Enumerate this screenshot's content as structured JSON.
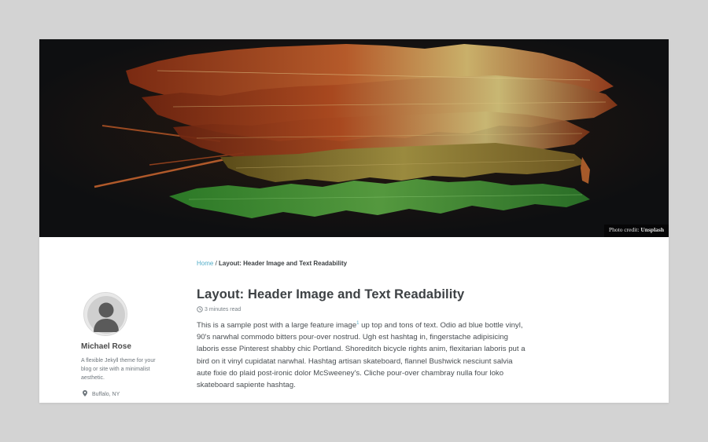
{
  "hero": {
    "photo_credit_prefix": "Photo credit:",
    "photo_credit_source": "Unsplash"
  },
  "breadcrumb": {
    "home": "Home",
    "separator": "/",
    "current": "Layout: Header Image and Text Readability"
  },
  "author": {
    "name": "Michael Rose",
    "bio": "A flexible Jekyll theme for your blog or site with a minimalist aesthetic.",
    "location": "Buffalo, NY",
    "location_icon": "map-marker-icon",
    "avatar_icon": "user-silhouette-icon"
  },
  "post": {
    "title": "Layout: Header Image and Text Readability",
    "read_time": "3 minutes read",
    "read_time_icon": "clock-icon",
    "paragraph_start": "This is a sample post with a large feature image",
    "footnote_ref": "1",
    "paragraph_rest": " up top and tons of text. Odio ad blue bottle vinyl, 90's narwhal commodo bitters pour-over nostrud. Ugh est hashtag in, fingerstache adipisicing laboris esse Pinterest shabby chic Portland. Shoreditch bicycle rights anim, flexitarian laboris put a bird on it vinyl cupidatat narwhal. Hashtag artisan skateboard, flannel Bushwick nesciunt salvia aute fixie do plaid post-ironic dolor McSweeney's. Cliche pour-over chambray nulla four loko skateboard sapiente hashtag."
  },
  "colors": {
    "page_background": "#d3d3d3",
    "link": "#52adc8",
    "text": "#494e52",
    "heading": "#3d4144"
  }
}
